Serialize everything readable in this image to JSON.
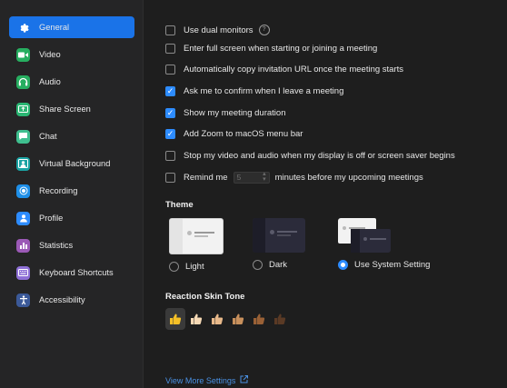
{
  "sidebar": {
    "items": [
      {
        "label": "General",
        "icon": "gear-icon",
        "color": "#1a73e8",
        "active": true
      },
      {
        "label": "Video",
        "icon": "video-camera-icon",
        "color": "#27ae60"
      },
      {
        "label": "Audio",
        "icon": "headphones-icon",
        "color": "#27ae60"
      },
      {
        "label": "Share Screen",
        "icon": "share-screen-icon",
        "color": "#2bb673"
      },
      {
        "label": "Chat",
        "icon": "chat-bubble-icon",
        "color": "#3fbf8f"
      },
      {
        "label": "Virtual Background",
        "icon": "person-frame-icon",
        "color": "#1aa3a3"
      },
      {
        "label": "Recording",
        "icon": "record-icon",
        "color": "#1e8fe8"
      },
      {
        "label": "Profile",
        "icon": "profile-icon",
        "color": "#2d8cff"
      },
      {
        "label": "Statistics",
        "icon": "bar-chart-icon",
        "color": "#9b59b6"
      },
      {
        "label": "Keyboard Shortcuts",
        "icon": "keyboard-icon",
        "color": "#8e6fd6"
      },
      {
        "label": "Accessibility",
        "icon": "accessibility-icon",
        "color": "#3b5998"
      }
    ]
  },
  "general": {
    "options": [
      {
        "label": "Use dual monitors",
        "checked": false,
        "help": true
      },
      {
        "label": "Enter full screen when starting or joining a meeting",
        "checked": false
      },
      {
        "label": "Automatically copy invitation URL once the meeting starts",
        "checked": false
      },
      {
        "label": "Ask me to confirm when I leave a meeting",
        "checked": true
      },
      {
        "label": "Show my meeting duration",
        "checked": true
      },
      {
        "label": "Add Zoom to macOS menu bar",
        "checked": true
      },
      {
        "label": "Stop my video and audio when my display is off or screen saver begins",
        "checked": false
      }
    ],
    "remind": {
      "prefix": "Remind me",
      "value": "5",
      "suffix": "minutes before my upcoming meetings",
      "checked": false
    },
    "theme": {
      "title": "Theme",
      "options": [
        {
          "label": "Light",
          "selected": false
        },
        {
          "label": "Dark",
          "selected": false
        },
        {
          "label": "Use System Setting",
          "selected": true
        }
      ]
    },
    "reaction": {
      "title": "Reaction Skin Tone",
      "tones": [
        "#f5c026",
        "#f6d9b5",
        "#e8b98a",
        "#c8905c",
        "#9a6136",
        "#5a3a25"
      ],
      "selected": 0
    },
    "view_more": "View More Settings"
  },
  "colors": {
    "accent": "#2d8cff",
    "active_item": "#1a73e8"
  }
}
